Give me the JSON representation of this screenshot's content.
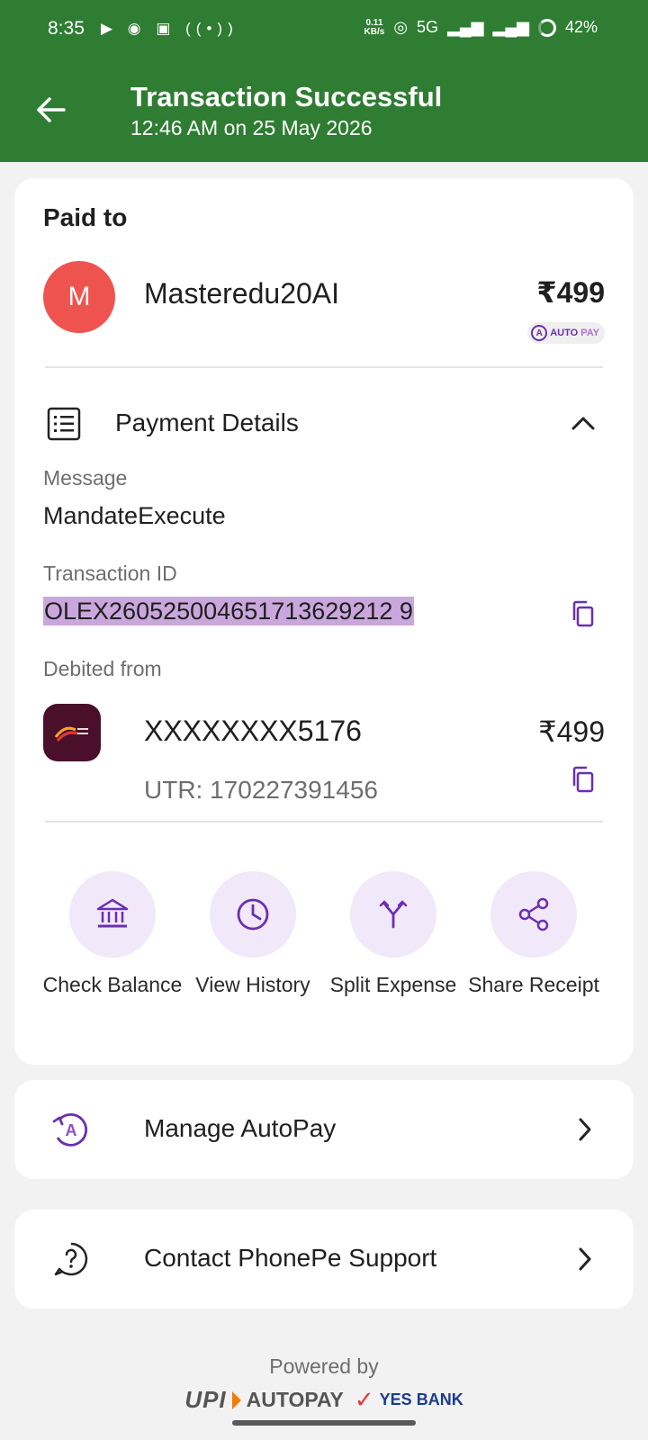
{
  "status_bar": {
    "time": "8:35",
    "net_speed_top": "0.11",
    "net_speed_bottom": "KB/s",
    "network": "5G",
    "battery": "42%"
  },
  "header": {
    "title": "Transaction Successful",
    "subtitle": "12:46 AM on 25 May 2026",
    "background_color": "#2e7d32"
  },
  "paid_to": {
    "heading": "Paid to",
    "avatar_initial": "M",
    "payee_name": "Masteredu20AI",
    "amount": "₹499",
    "badge_auto": "AUTO",
    "badge_pay": "PAY"
  },
  "payment_details": {
    "title": "Payment Details",
    "message_label": "Message",
    "message_value": "MandateExecute",
    "txn_label": "Transaction ID",
    "txn_value": "OLEX260525004651713629212 9",
    "debited_label": "Debited from",
    "account_number": "XXXXXXXX5176",
    "debited_amount": "₹499",
    "utr": "UTR: 170227391456"
  },
  "actions": [
    {
      "label": "Check Balance",
      "icon": "bank-icon"
    },
    {
      "label": "View History",
      "icon": "clock-icon"
    },
    {
      "label": "Split Expense",
      "icon": "split-icon"
    },
    {
      "label": "Share Receipt",
      "icon": "share-icon"
    }
  ],
  "rows": {
    "manage_autopay": "Manage AutoPay",
    "contact_support": "Contact PhonePe Support"
  },
  "footer": {
    "powered_by": "Powered by",
    "upi": "UPI",
    "autopay": "AUTOPAY",
    "bank": "YES BANK"
  },
  "colors": {
    "accent_purple": "#6a2fb0",
    "action_circle": "#f1e8fa",
    "avatar_red": "#ef5350",
    "highlight": "#c9a7dc"
  }
}
